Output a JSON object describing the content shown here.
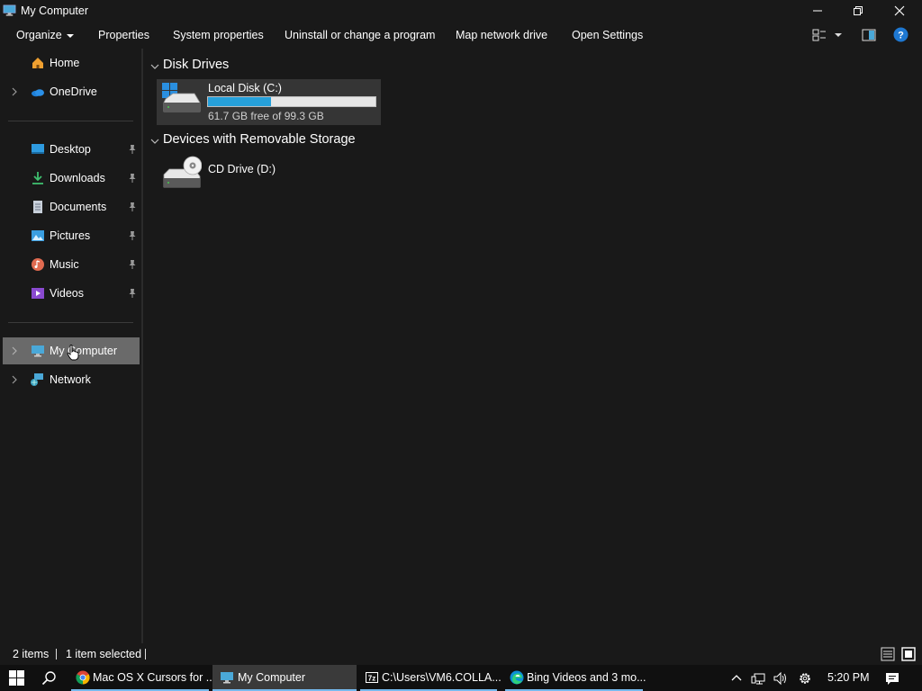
{
  "window": {
    "title": "My Computer"
  },
  "toolbar": {
    "organize": "Organize",
    "properties": "Properties",
    "system_properties": "System properties",
    "uninstall": "Uninstall or change a program",
    "map_drive": "Map network drive",
    "open_settings": "Open Settings"
  },
  "nav": {
    "home": "Home",
    "onedrive": "OneDrive",
    "quick_access": [
      "Desktop",
      "Downloads",
      "Documents",
      "Pictures",
      "Music",
      "Videos"
    ],
    "my_computer": "My Computer",
    "network": "Network"
  },
  "content": {
    "disk_drives_header": "Disk Drives",
    "drive_c": {
      "label": "Local Disk (C:)",
      "free_text": "61.7 GB free of 99.3 GB",
      "used_fraction": 0.379
    },
    "removable_header": "Devices with Removable Storage",
    "drive_d": {
      "label": "CD Drive (D:)"
    }
  },
  "status": {
    "items": "2 items",
    "selected": "1 item selected"
  },
  "taskbar": {
    "tasks": [
      {
        "label": "Mac OS X Cursors for ...",
        "icon": "chrome-icon"
      },
      {
        "label": "My Computer",
        "icon": "computer-icon",
        "active": true
      },
      {
        "label": "C:\\Users\\VM6.COLLA...",
        "icon": "7zip-icon"
      },
      {
        "label": "Bing Videos and 3 mo...",
        "icon": "edge-icon"
      }
    ],
    "time": "5:20 PM"
  },
  "colors": {
    "accent": "#26a0da",
    "selected": "#6a6a6a",
    "background": "#191919"
  }
}
